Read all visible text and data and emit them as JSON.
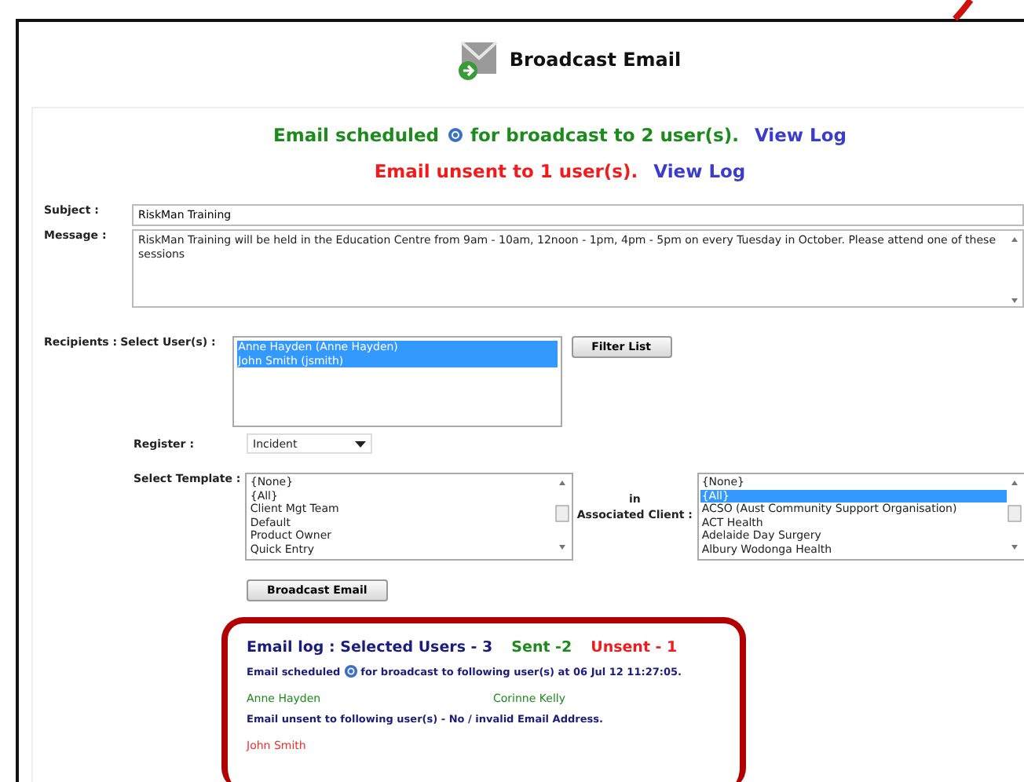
{
  "title": "Broadcast Email",
  "notices": [
    {
      "kind": "scheduled",
      "text": "Email scheduled",
      "after": "for broadcast to 2 user(s).",
      "link": "View Log"
    },
    {
      "kind": "unsent",
      "text": "Email unsent to 1 user(s).",
      "link": "View Log"
    }
  ],
  "subject": {
    "label": "Subject :",
    "value": "RiskMan Training"
  },
  "message": {
    "label": "Message :",
    "value": "RiskMan Training will be held in the Education Centre from 9am - 10am, 12noon - 1pm, 4pm - 5pm on every Tuesday in October. Please attend one of these sessions"
  },
  "recipients": {
    "label": "Recipients :",
    "sublabel": "Select User(s) :",
    "items": [
      {
        "text": "Anne Hayden (Anne Hayden)",
        "selected": true
      },
      {
        "text": "John Smith (jsmith)",
        "selected": true
      }
    ],
    "button": "Filter List"
  },
  "register": {
    "label": "Register :",
    "value": "Incident"
  },
  "template": {
    "label": "Select Template :",
    "items": [
      {
        "text": "{None}",
        "selected": false
      },
      {
        "text": "{All}",
        "selected": false
      },
      {
        "text": "Client Mgt Team",
        "selected": false
      },
      {
        "text": "Default",
        "selected": false
      },
      {
        "text": "Product Owner",
        "selected": false
      },
      {
        "text": "Quick Entry",
        "selected": false
      }
    ]
  },
  "client": {
    "label_top": "in",
    "label": "Associated Client :",
    "items": [
      {
        "text": "{None}",
        "selected": false
      },
      {
        "text": "{All}",
        "selected": true
      },
      {
        "text": "ACSO (Aust Community Support Organisation)",
        "selected": false
      },
      {
        "text": "ACT Health",
        "selected": false
      },
      {
        "text": "Adelaide Day Surgery",
        "selected": false
      },
      {
        "text": "Albury Wodonga Health",
        "selected": false
      }
    ]
  },
  "submit": "Broadcast Email",
  "log": {
    "title": "Email log : Selected Users - 3",
    "sent": "Sent -2",
    "unsent": "Unsent - 1",
    "scheduled_before": "Email scheduled",
    "scheduled_after": "for broadcast to following user(s) at 06 Jul 12 11:27:05.",
    "sent_users": [
      "Anne Hayden",
      "Corinne Kelly"
    ],
    "unsent_heading": "Email unsent to following user(s) - No / invalid Email Address.",
    "unsent_users": [
      "John Smith"
    ]
  }
}
